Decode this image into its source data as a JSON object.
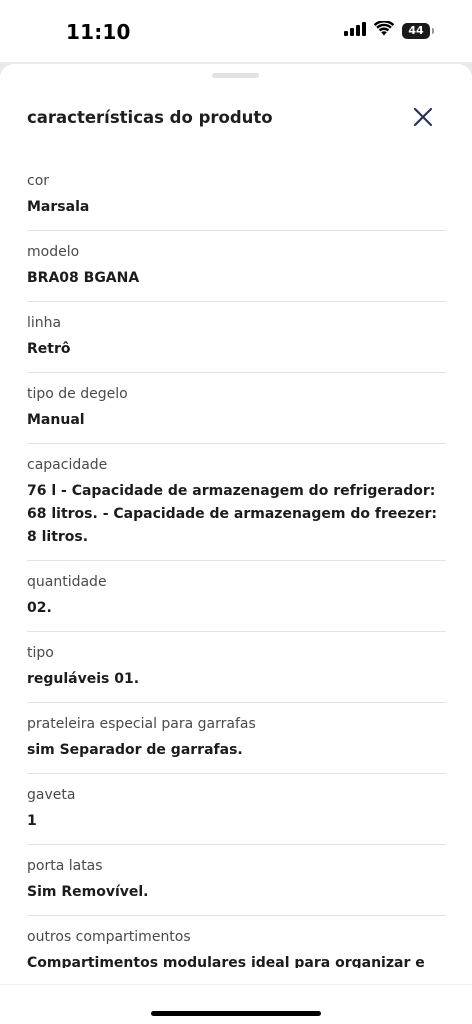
{
  "status_bar": {
    "time": "11:10",
    "battery": "44",
    "icons": [
      "cellular-signal-icon",
      "wifi-icon",
      "battery-icon"
    ]
  },
  "sheet": {
    "title": "características do produto",
    "close_icon": "close-icon"
  },
  "specs": [
    {
      "label": "cor",
      "value": "Marsala"
    },
    {
      "label": "modelo",
      "value": "BRA08 BGANA"
    },
    {
      "label": "linha",
      "value": "Retrô"
    },
    {
      "label": "tipo de degelo",
      "value": "Manual"
    },
    {
      "label": "capacidade",
      "value": "76 l - Capacidade de armazenagem do refrigerador: 68 litros. - Capacidade de armazenagem do freezer: 8 litros."
    },
    {
      "label": "quantidade",
      "value": "02."
    },
    {
      "label": "tipo",
      "value": "reguláveis 01."
    },
    {
      "label": "prateleira especial para garrafas",
      "value": "sim Separador de garrafas."
    },
    {
      "label": "gaveta",
      "value": "1"
    },
    {
      "label": "porta latas",
      "value": "Sim Removível."
    },
    {
      "label": "outros compartimentos",
      "value": "Compartimentos modulares ideal para organizar e personalizar o interior do frigobar."
    }
  ],
  "colors": {
    "title_text": "#1f1f1f",
    "label_text": "#4a4a4a",
    "close_icon": "#2b3457",
    "divider": "#e3e3e3"
  }
}
